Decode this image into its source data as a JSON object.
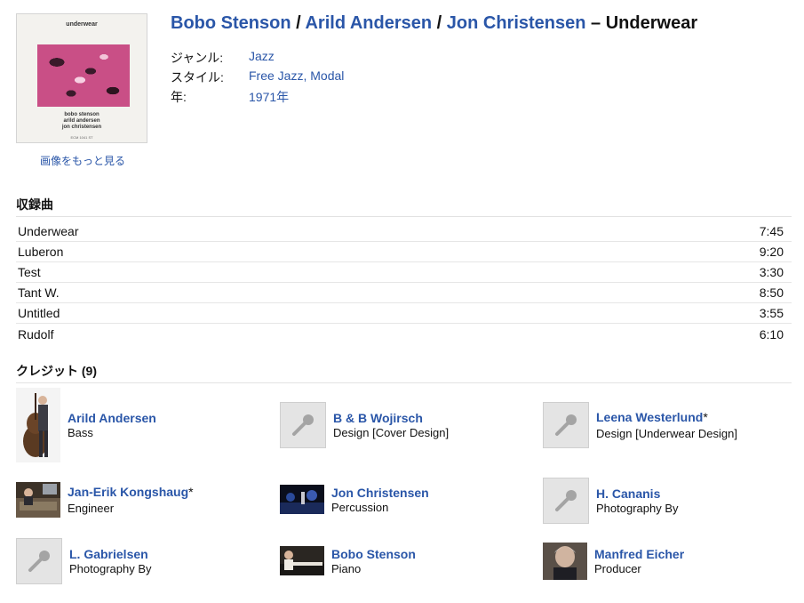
{
  "cover": {
    "art_title": "underwear",
    "art_names": [
      "bobo stenson",
      "arild andersen",
      "jon christensen"
    ],
    "art_label": "ECM 1041 ST",
    "more_images": "画像をもっと見る"
  },
  "header": {
    "artists": [
      "Bobo Stenson",
      "Arild Andersen",
      "Jon Christensen"
    ],
    "separator": " / ",
    "dash": " – ",
    "album": "Underwear"
  },
  "meta": [
    {
      "label": "ジャンル:",
      "value": "Jazz"
    },
    {
      "label": "スタイル:",
      "value": "Free Jazz, Modal"
    },
    {
      "label": "年:",
      "value": "1971年"
    }
  ],
  "tracklist": {
    "heading": "収録曲",
    "tracks": [
      {
        "title": "Underwear",
        "duration": "7:45"
      },
      {
        "title": "Luberon",
        "duration": "9:20"
      },
      {
        "title": "Test",
        "duration": "3:30"
      },
      {
        "title": "Tant W.",
        "duration": "8:50"
      },
      {
        "title": "Untitled",
        "duration": "3:55"
      },
      {
        "title": "Rudolf",
        "duration": "6:10"
      }
    ]
  },
  "credits": {
    "heading": "クレジット",
    "count": "(9)",
    "items": [
      {
        "name": "Arild Andersen",
        "star": "",
        "role": "Bass"
      },
      {
        "name": "B & B Wojirsch",
        "star": "",
        "role": "Design [Cover Design]"
      },
      {
        "name": "Leena Westerlund",
        "star": "*",
        "role": "Design [Underwear Design]"
      },
      {
        "name": "Jan-Erik Kongshaug",
        "star": "*",
        "role": "Engineer"
      },
      {
        "name": "Jon Christensen",
        "star": "",
        "role": "Percussion"
      },
      {
        "name": "H. Cananis",
        "star": "",
        "role": "Photography By"
      },
      {
        "name": "L. Gabrielsen",
        "star": "",
        "role": "Photography By"
      },
      {
        "name": "Bobo Stenson",
        "star": "",
        "role": "Piano"
      },
      {
        "name": "Manfred Eicher",
        "star": "",
        "role": "Producer"
      }
    ]
  },
  "colors": {
    "link": "#2a56a8",
    "rule": "#e2e2e2",
    "placeholder": "#e4e4e4"
  }
}
